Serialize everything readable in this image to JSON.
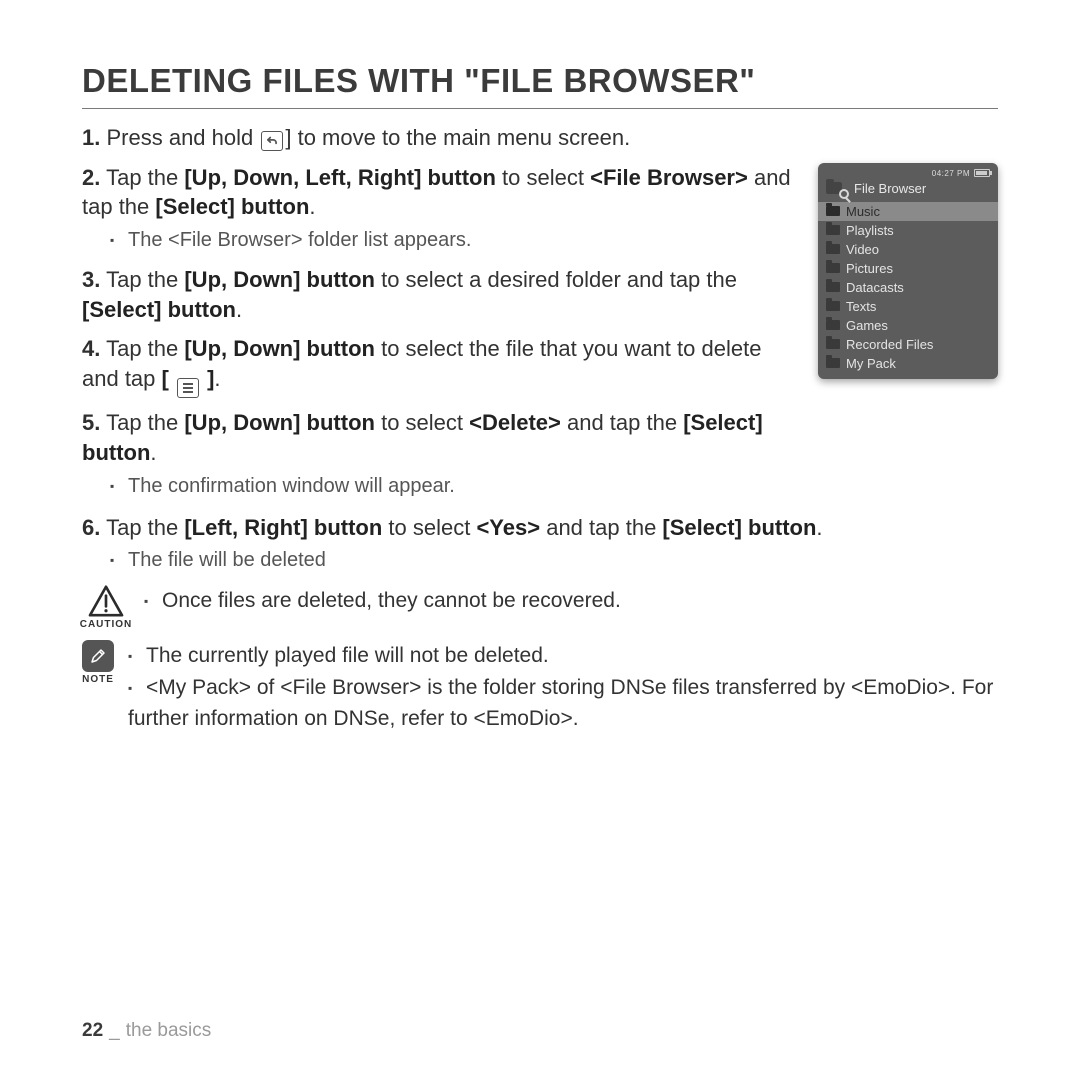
{
  "title": "DELETING FILES WITH \"FILE BROWSER\"",
  "steps": {
    "s1": {
      "t1": "Press and hold ",
      "t2": " to move to the main menu screen."
    },
    "s2": {
      "t1": "Tap the ",
      "b1": "[Up, Down, Left, Right] button",
      "t2": " to select ",
      "b2": "<File Browser>",
      "t3": " and tap the ",
      "b3": "[Select] button",
      "t4": ".",
      "sub1": "The <File Browser> folder list appears."
    },
    "s3": {
      "t1": "Tap the ",
      "b1": "[Up, Down] button",
      "t2": " to select a desired folder and tap the ",
      "b2": "[Select] button",
      "t3": "."
    },
    "s4": {
      "t1": "Tap the ",
      "b1": "[Up, Down] button",
      "t2": " to select the file that you want to delete and tap ",
      "t3": "."
    },
    "s5": {
      "t1": "Tap the ",
      "b1": "[Up, Down] button",
      "t2": " to select ",
      "b2": "<Delete>",
      "t3": " and tap the ",
      "b3": "[Select] button",
      "t4": ".",
      "sub1": "The confirmation window will appear."
    },
    "s6": {
      "t1": "Tap the ",
      "b1": "[Left, Right] button",
      "t2": " to select ",
      "b2": "<Yes>",
      "t3": " and tap the ",
      "b3": "[Select] button",
      "t4": ".",
      "sub1": "The file will be deleted"
    }
  },
  "caution": {
    "label": "CAUTION",
    "item1": "Once files are deleted, they cannot be recovered."
  },
  "note": {
    "label": "NOTE",
    "item1": "The currently played file will not be deleted.",
    "item2": "<My Pack> of <File Browser> is the folder storing DNSe files transferred by <EmoDio>. For further information on DNSe, refer to <EmoDio>."
  },
  "device": {
    "time": "04:27 PM",
    "title": "File Browser",
    "items": [
      "Music",
      "Playlists",
      "Video",
      "Pictures",
      "Datacasts",
      "Texts",
      "Games",
      "Recorded Files",
      "My Pack"
    ],
    "selected": "Music"
  },
  "footer": {
    "page": "22",
    "section": "the basics"
  }
}
